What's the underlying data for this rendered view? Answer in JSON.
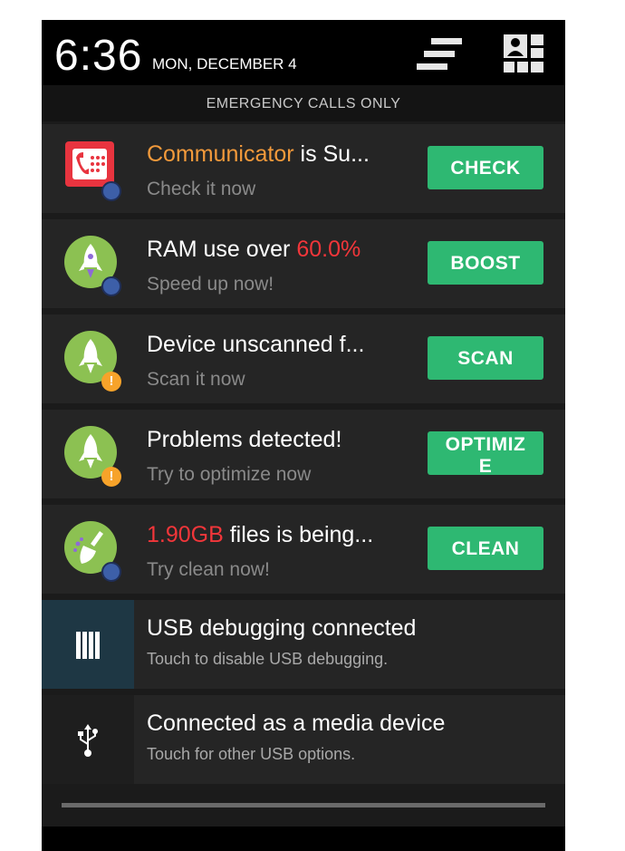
{
  "status_bar": {
    "time": "6:36",
    "date": "MON, DECEMBER 4"
  },
  "carrier_text": "EMERGENCY CALLS ONLY",
  "notifications": [
    {
      "title_highlight": "Communicator",
      "title_rest": " is Su...",
      "subtitle": "Check it now",
      "button": "CHECK",
      "icon": "phone-app-icon",
      "badge": "shield-icon"
    },
    {
      "title_pre": "RAM use over ",
      "title_highlight": "60.0%",
      "subtitle": "Speed up now!",
      "button": "BOOST",
      "icon": "rocket-icon",
      "badge": "shield-icon"
    },
    {
      "title": "Device unscanned f...",
      "subtitle": "Scan it now",
      "button": "SCAN",
      "icon": "rocket-icon",
      "badge": "warning-icon"
    },
    {
      "title": "Problems detected!",
      "subtitle": "Try to optimize now",
      "button": "OPTIMIZE",
      "icon": "rocket-icon",
      "badge": "warning-icon"
    },
    {
      "title_highlight": "1.90GB",
      "title_rest": " files is being...",
      "subtitle": "Try clean now!",
      "button": "CLEAN",
      "icon": "broom-icon",
      "badge": "shield-icon"
    }
  ],
  "system_notifications": [
    {
      "title": "USB debugging connected",
      "subtitle": "Touch to disable USB debugging.",
      "icon": "usb-debug-icon"
    },
    {
      "title": "Connected as a media device",
      "subtitle": "Touch for other USB options.",
      "icon": "usb-icon"
    }
  ],
  "colors": {
    "button_green": "#2eb872",
    "highlight_orange": "#f39a3b",
    "highlight_red": "#f2363a",
    "icon_green": "#8cc152"
  }
}
